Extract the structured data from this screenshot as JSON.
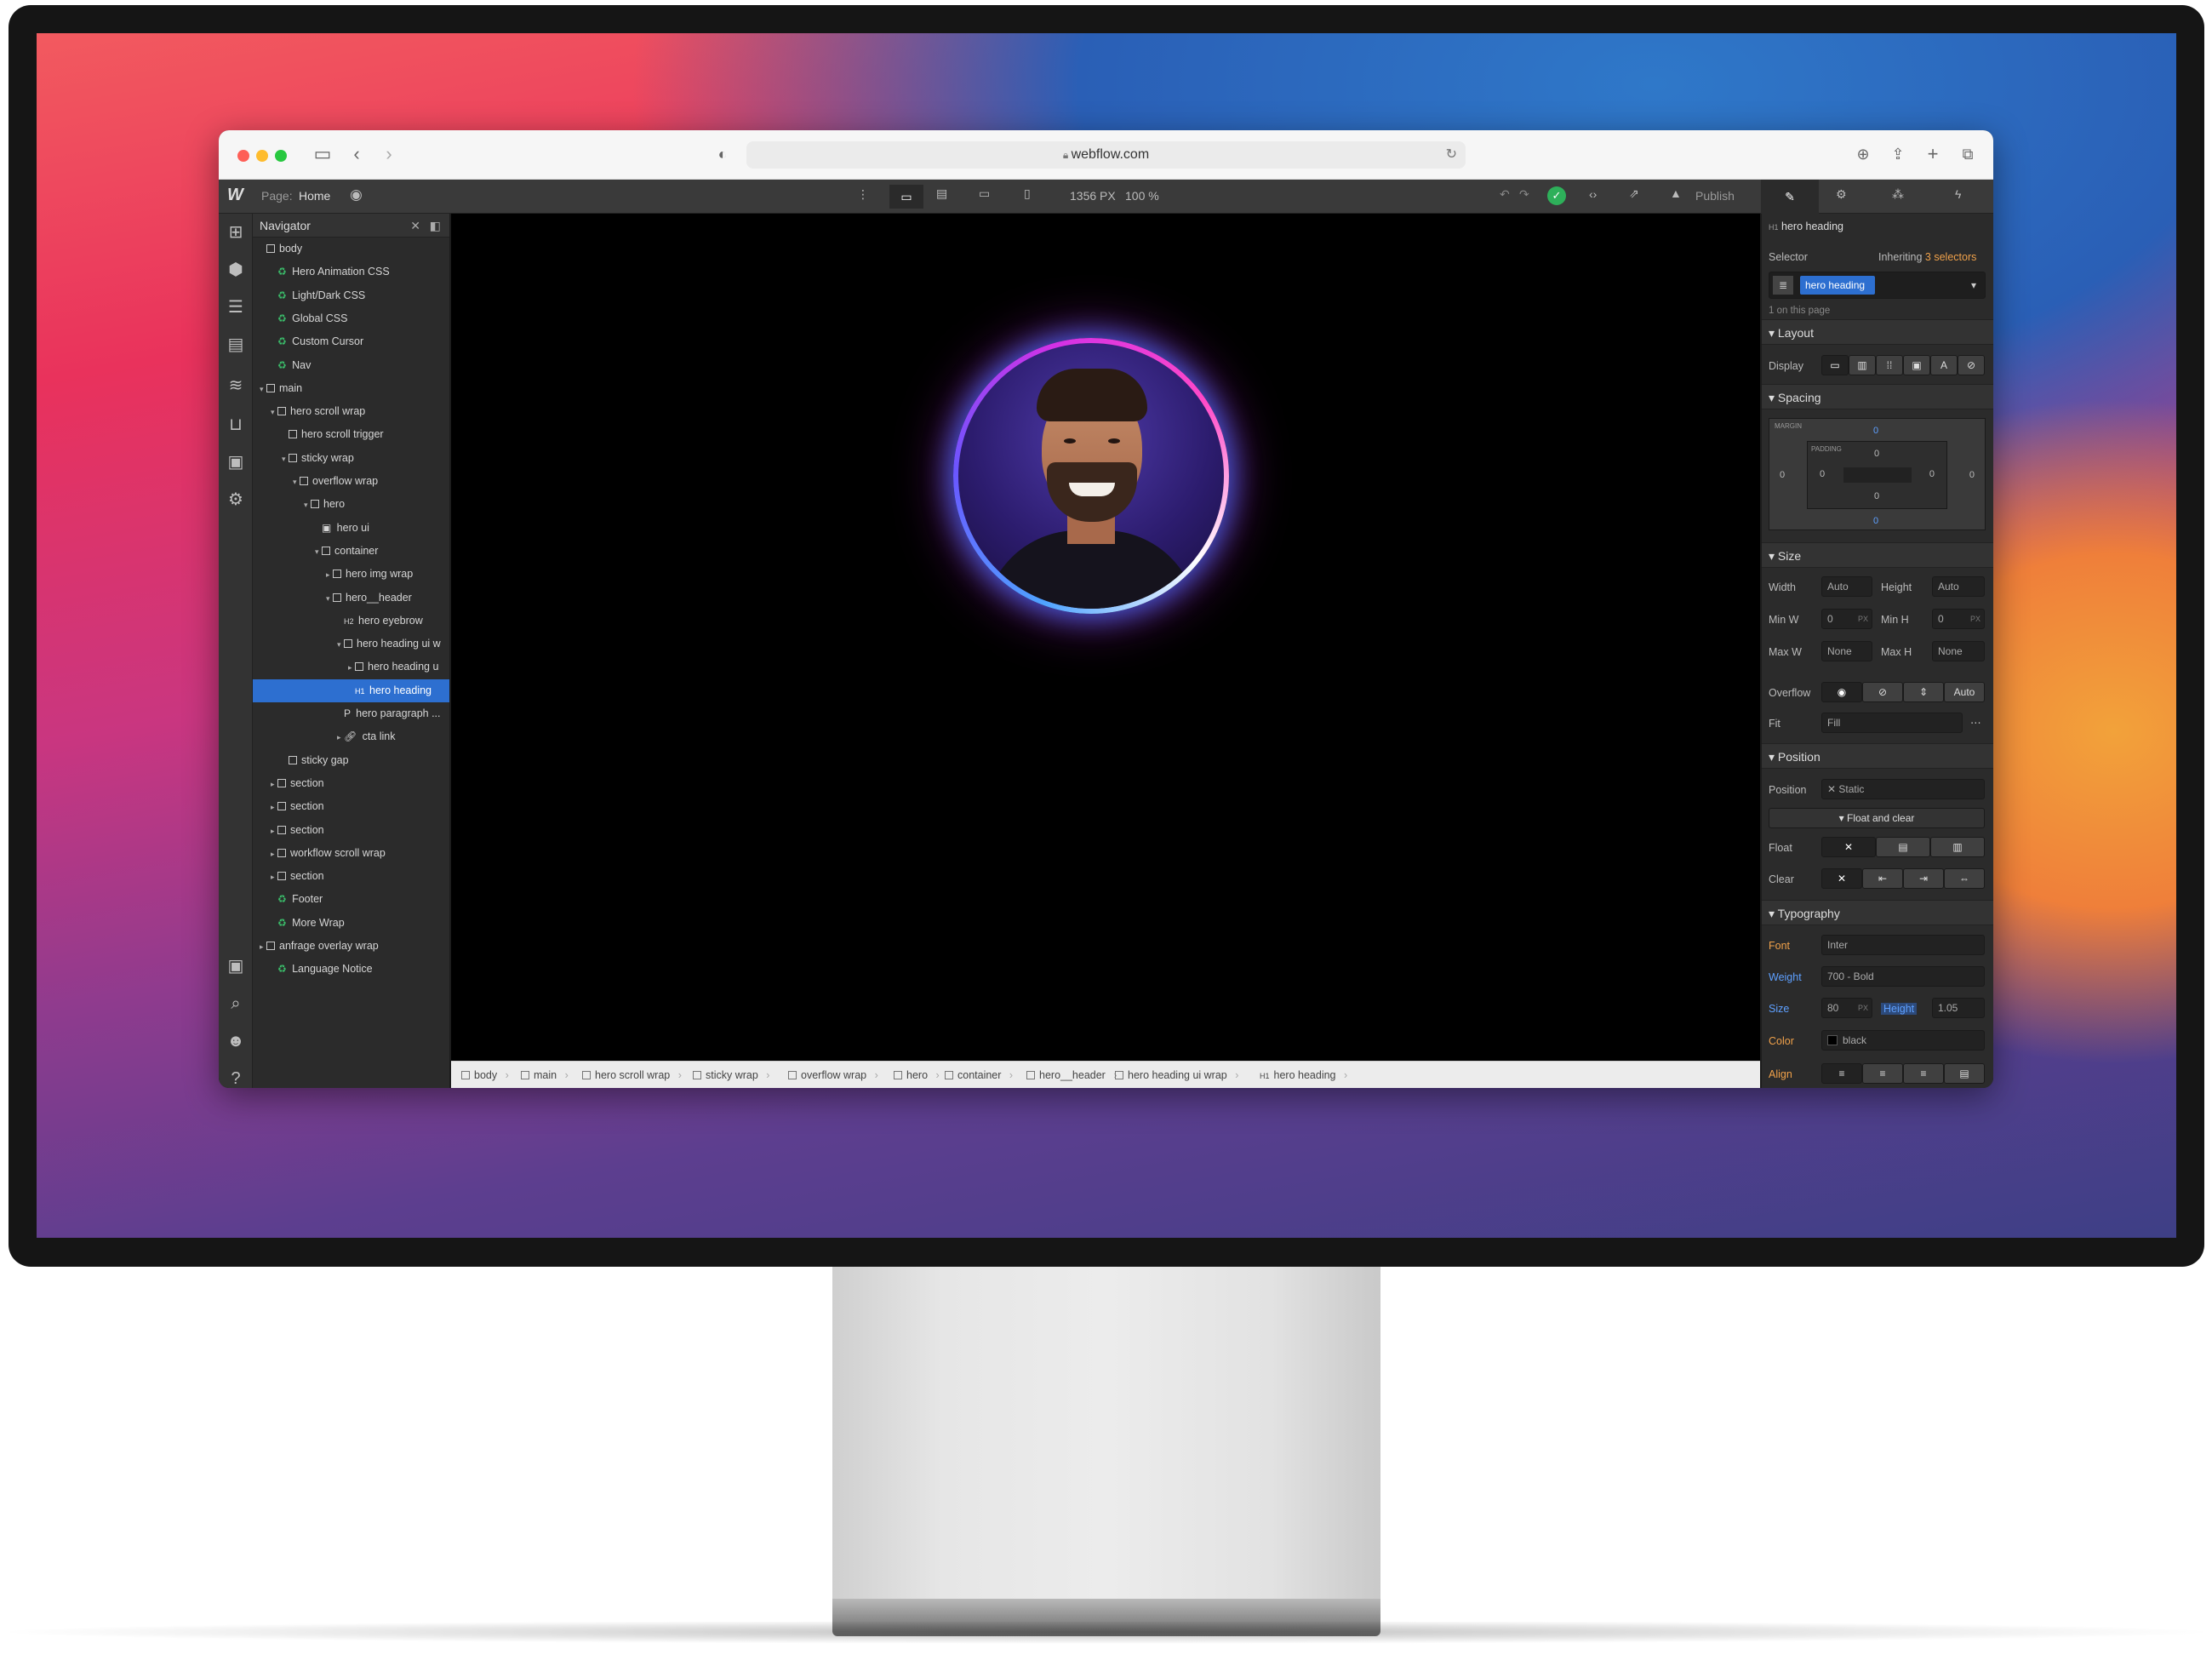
{
  "browser": {
    "url": "webflow.com"
  },
  "topbar": {
    "page_label": "Page:",
    "page_name": "Home",
    "viewport_width": "1356 PX",
    "zoom": "100 %",
    "publish": "Publish"
  },
  "navigator": {
    "title": "Navigator",
    "items": [
      {
        "label": "body",
        "kind": "box",
        "depth": 0
      },
      {
        "label": "Hero Animation CSS",
        "kind": "symbol",
        "depth": 1
      },
      {
        "label": "Light/Dark CSS",
        "kind": "symbol",
        "depth": 1
      },
      {
        "label": "Global CSS",
        "kind": "symbol",
        "depth": 1
      },
      {
        "label": "Custom Cursor",
        "kind": "symbol",
        "depth": 1
      },
      {
        "label": "Nav",
        "kind": "symbol",
        "depth": 1
      },
      {
        "label": "main",
        "kind": "box",
        "depth": 0,
        "expanded": true
      },
      {
        "label": "hero scroll wrap",
        "kind": "box",
        "depth": 1,
        "expanded": true
      },
      {
        "label": "hero scroll trigger",
        "kind": "box",
        "depth": 2
      },
      {
        "label": "sticky wrap",
        "kind": "box",
        "depth": 2,
        "expanded": true
      },
      {
        "label": "overflow wrap",
        "kind": "box",
        "depth": 3,
        "expanded": true
      },
      {
        "label": "hero",
        "kind": "box",
        "depth": 4,
        "expanded": true
      },
      {
        "label": "hero ui",
        "kind": "img",
        "depth": 5
      },
      {
        "label": "container",
        "kind": "box",
        "depth": 5,
        "expanded": true
      },
      {
        "label": "hero img wrap",
        "kind": "box",
        "depth": 6,
        "collapsed": true
      },
      {
        "label": "hero__header",
        "kind": "box",
        "depth": 6,
        "expanded": true
      },
      {
        "label": "hero eyebrow",
        "kind": "h2",
        "depth": 7
      },
      {
        "label": "hero heading ui w",
        "kind": "box",
        "depth": 7,
        "expanded": true
      },
      {
        "label": "hero heading u",
        "kind": "box",
        "depth": 8,
        "collapsed": true
      },
      {
        "label": "hero heading",
        "kind": "h1",
        "depth": 8,
        "selected": true
      },
      {
        "label": "hero paragraph ...",
        "kind": "p",
        "depth": 7
      },
      {
        "label": "cta link",
        "kind": "link",
        "depth": 7,
        "collapsed": true
      },
      {
        "label": "sticky gap",
        "kind": "box",
        "depth": 2
      },
      {
        "label": "section",
        "kind": "box",
        "depth": 1,
        "collapsed": true
      },
      {
        "label": "section",
        "kind": "box",
        "depth": 1,
        "collapsed": true
      },
      {
        "label": "section",
        "kind": "box",
        "depth": 1,
        "collapsed": true
      },
      {
        "label": "workflow scroll wrap",
        "kind": "box",
        "depth": 1,
        "collapsed": true
      },
      {
        "label": "section",
        "kind": "box",
        "depth": 1,
        "collapsed": true
      },
      {
        "label": "Footer",
        "kind": "symbol",
        "depth": 1
      },
      {
        "label": "More Wrap",
        "kind": "symbol",
        "depth": 1
      },
      {
        "label": "anfrage overlay wrap",
        "kind": "box",
        "depth": 0,
        "collapsed": true
      },
      {
        "label": "Language Notice",
        "kind": "symbol",
        "depth": 1
      }
    ]
  },
  "breadcrumbs": [
    "body",
    "main",
    "hero scroll wrap",
    "sticky wrap",
    "overflow wrap",
    "hero",
    "container",
    "hero__header",
    "hero heading ui wrap",
    "hero heading"
  ],
  "breadcrumb_last_tag": "H1",
  "style_panel": {
    "element_tag": "H1",
    "element_name": "hero heading",
    "selector_label": "Selector",
    "inheriting_label": "Inheriting",
    "inheriting_count": "3 selectors",
    "selector_chip": "hero heading",
    "on_page": "1 on this page",
    "layout": {
      "title": "Layout",
      "display_label": "Display"
    },
    "spacing": {
      "title": "Spacing",
      "margin_label": "MARGIN",
      "padding_label": "PADDING",
      "margin": {
        "top": "0",
        "right": "0",
        "bottom": "0",
        "left": "0"
      },
      "padding": {
        "top": "0",
        "right": "0",
        "bottom": "0",
        "left": "0"
      }
    },
    "size": {
      "title": "Size",
      "width_label": "Width",
      "width": "Auto",
      "height_label": "Height",
      "height": "Auto",
      "minw_label": "Min W",
      "minw": "0",
      "minh_label": "Min H",
      "minh": "0",
      "px": "PX",
      "maxw_label": "Max W",
      "maxw": "None",
      "maxh_label": "Max H",
      "maxh": "None",
      "overflow_label": "Overflow",
      "overflow_auto": "Auto",
      "fit_label": "Fit",
      "fit": "Fill"
    },
    "position": {
      "title": "Position",
      "position_label": "Position",
      "position_value": "Static",
      "float_clear": "Float and clear",
      "float_label": "Float",
      "clear_label": "Clear"
    },
    "typography": {
      "title": "Typography",
      "font_label": "Font",
      "font": "Inter",
      "weight_label": "Weight",
      "weight": "700 - Bold",
      "size_label": "Size",
      "size": "80",
      "size_unit": "PX",
      "height_label": "Height",
      "height": "1.05",
      "color_label": "Color",
      "color": "black",
      "align_label": "Align"
    }
  },
  "colors": {
    "accent": "#2d6fd0",
    "symbol_green": "#3bbf6b",
    "publish_check": "#2eb05a"
  }
}
